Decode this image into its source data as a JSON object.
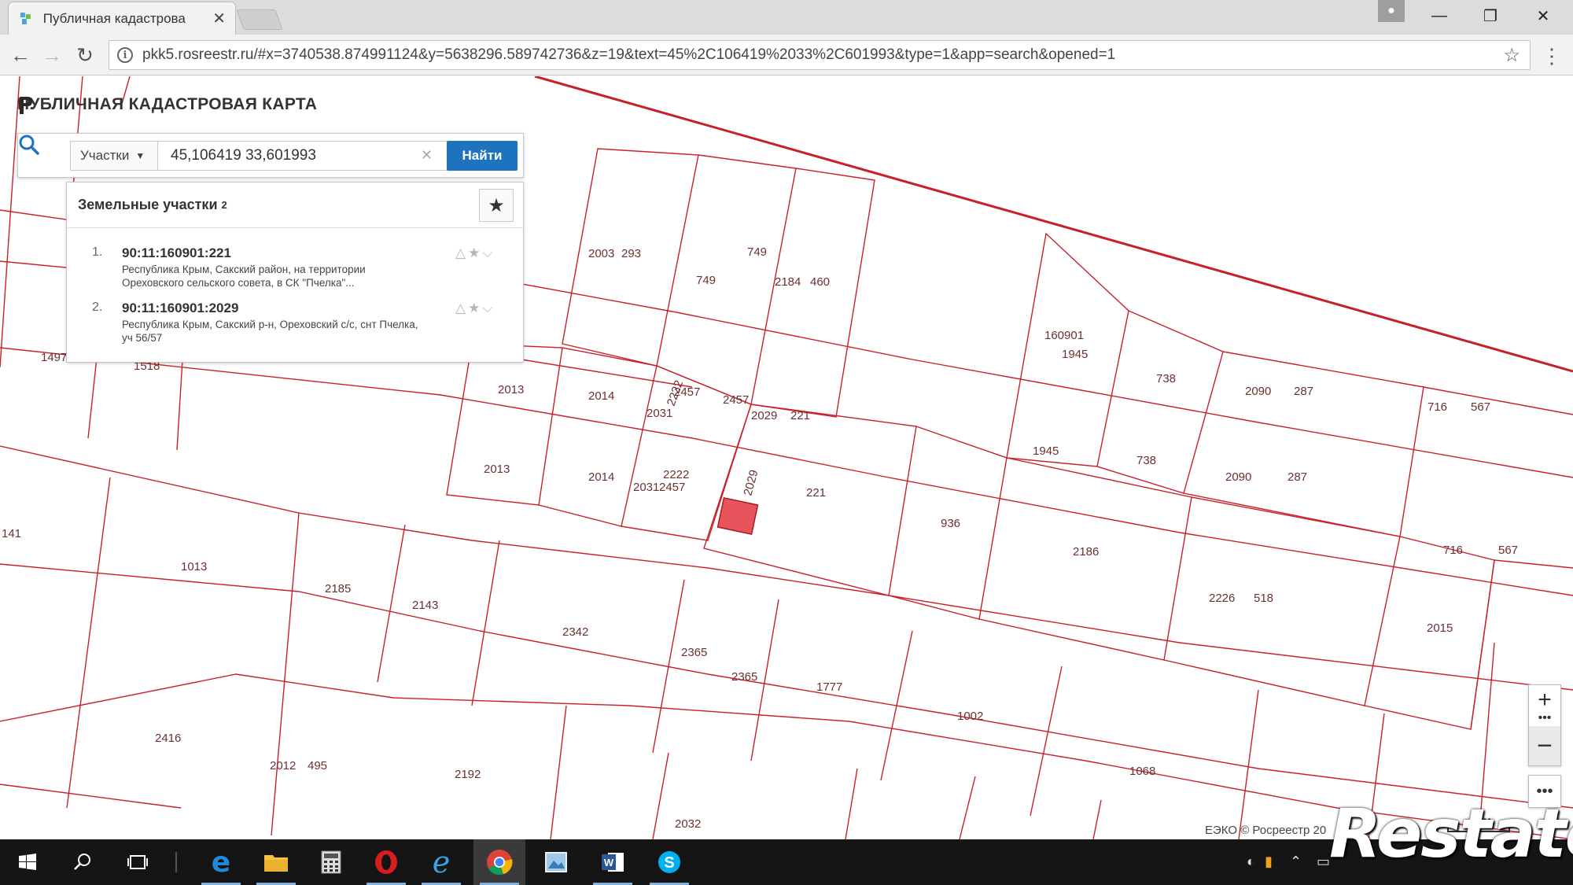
{
  "browser": {
    "tab_title": "Публичная кадастрова",
    "url": "pkk5.rosreestr.ru/#x=3740538.874991124&y=5638296.589742736&z=19&text=45%2C106419%2033%2C601993&type=1&app=search&opened=1"
  },
  "app": {
    "title": "ПУБЛИЧНАЯ КАДАСТРОВАЯ КАРТА"
  },
  "search": {
    "type_label": "Участки",
    "query": "45,106419 33,601993",
    "button_label": "Найти"
  },
  "results": {
    "title": "Земельные участки",
    "count": "2",
    "items": [
      {
        "num": "1.",
        "cadastral": "90:11:160901:221",
        "address": "Республика Крым, Сакский район, на территории Ореховского сельского совета, в СК \"Пчелка\"..."
      },
      {
        "num": "2.",
        "cadastral": "90:11:160901:2029",
        "address": "Республика Крым, Сакский р-н, Ореховский с/с, снт Пчелка, уч 56/57"
      }
    ]
  },
  "map": {
    "quarter_label": "160901",
    "parcel_labels": [
      "1497",
      "1518",
      "2003",
      "293",
      "749",
      "749",
      "2184",
      "460",
      "160901",
      "1945",
      "738",
      "738",
      "2090",
      "287",
      "2090",
      "287",
      "716",
      "567",
      "716",
      "567",
      "2013",
      "2014",
      "2457",
      "2222",
      "2031",
      "2457",
      "2029",
      "221",
      "2013",
      "2014",
      "2222",
      "2031",
      "2457",
      "2029",
      "221",
      "936",
      "1945",
      "141",
      "1013",
      "2185",
      "2143",
      "2342",
      "2365",
      "2365",
      "1777",
      "1002",
      "2186",
      "2226",
      "518",
      "2015",
      "2416",
      "2012",
      "495",
      "2192",
      "2032",
      "1068"
    ],
    "attribution": "ЕЭКО © Росреестр 20",
    "scale": "20м",
    "colors": {
      "boundary": "#c8202a",
      "highlight": "#e8545c"
    }
  },
  "controls": {
    "zoom_in": "+",
    "zoom_out": "−",
    "more": "•••"
  },
  "taskbar": {
    "icons": [
      "windows-start-icon",
      "search-icon",
      "task-view-icon",
      "edge-icon",
      "file-explorer-icon",
      "calculator-icon",
      "opera-icon",
      "internet-explorer-icon",
      "chrome-icon",
      "paint-icon",
      "word-icon",
      "skype-icon"
    ]
  },
  "watermark": "Restate"
}
